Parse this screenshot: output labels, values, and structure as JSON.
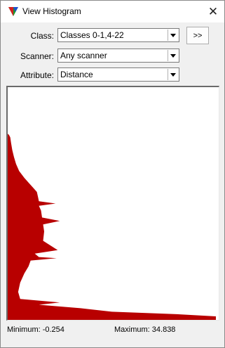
{
  "window": {
    "title": "View Histogram",
    "close_glyph": "✕",
    "icon": "tricolor-triangle-icon"
  },
  "form": {
    "class_label": "Class:",
    "class_value": "Classes 0-1,4-22",
    "scanner_label": "Scanner:",
    "scanner_value": "Any scanner",
    "attribute_label": "Attribute:",
    "attribute_value": "Distance",
    "more_button_label": ">>"
  },
  "stats": {
    "minimum_text": "Minimum: -0.254",
    "maximum_text": "Maximum: 34.838"
  },
  "chart_data": {
    "type": "bar",
    "orientation": "horizontal",
    "bar_color": "#b80000",
    "x_range": [
      0,
      1
    ],
    "y_range": [
      -0.254,
      34.838
    ],
    "title": "",
    "xlabel": "",
    "ylabel": "",
    "profile": [
      [
        0.0,
        0.0
      ],
      [
        0.2,
        0.0
      ],
      [
        0.205,
        0.006
      ],
      [
        0.215,
        0.012
      ],
      [
        0.24,
        0.016
      ],
      [
        0.27,
        0.022
      ],
      [
        0.3,
        0.03
      ],
      [
        0.33,
        0.04
      ],
      [
        0.36,
        0.055
      ],
      [
        0.39,
        0.08
      ],
      [
        0.41,
        0.1
      ],
      [
        0.43,
        0.12
      ],
      [
        0.45,
        0.14
      ],
      [
        0.47,
        0.145
      ],
      [
        0.49,
        0.15
      ],
      [
        0.5,
        0.23
      ],
      [
        0.51,
        0.15
      ],
      [
        0.53,
        0.16
      ],
      [
        0.56,
        0.165
      ],
      [
        0.575,
        0.25
      ],
      [
        0.59,
        0.17
      ],
      [
        0.62,
        0.175
      ],
      [
        0.66,
        0.17
      ],
      [
        0.7,
        0.24
      ],
      [
        0.715,
        0.13
      ],
      [
        0.73,
        0.15
      ],
      [
        0.735,
        0.235
      ],
      [
        0.745,
        0.11
      ],
      [
        0.77,
        0.1
      ],
      [
        0.8,
        0.08
      ],
      [
        0.84,
        0.06
      ],
      [
        0.88,
        0.05
      ],
      [
        0.91,
        0.06
      ],
      [
        0.925,
        0.25
      ],
      [
        0.935,
        0.15
      ],
      [
        0.95,
        0.35
      ],
      [
        0.965,
        0.5
      ],
      [
        0.975,
        0.8
      ],
      [
        0.985,
        1.0
      ],
      [
        1.0,
        1.0
      ]
    ]
  }
}
